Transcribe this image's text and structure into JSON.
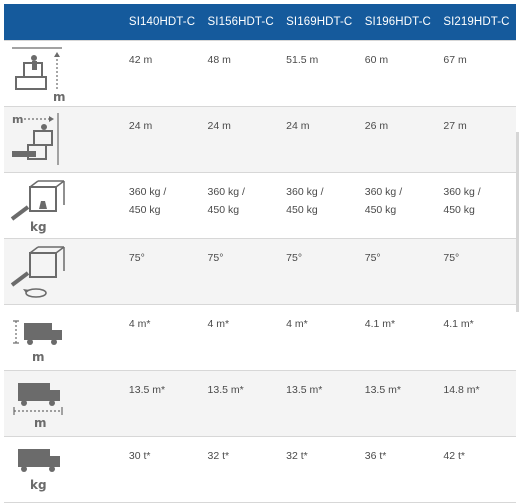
{
  "columns": [
    "SI140HDT-C",
    "SI156HDT-C",
    "SI169HDT-C",
    "SI196HDT-C",
    "SI219HDT-C"
  ],
  "rows": [
    {
      "icon": "working-height-icon",
      "icon_label": "m",
      "values": [
        "42 m",
        "48 m",
        "51.5 m",
        "60 m",
        "67 m"
      ]
    },
    {
      "icon": "horizontal-outreach-icon",
      "icon_label": "m",
      "values": [
        "24 m",
        "24 m",
        "24 m",
        "26 m",
        "27 m"
      ]
    },
    {
      "icon": "platform-capacity-icon",
      "icon_label": "kg",
      "values": [
        [
          "360 kg /",
          "450 kg"
        ],
        [
          "360 kg /",
          "450 kg"
        ],
        [
          "360 kg /",
          "450 kg"
        ],
        [
          "360 kg /",
          "450 kg"
        ],
        [
          "360 kg /",
          "450 kg"
        ]
      ]
    },
    {
      "icon": "platform-rotation-icon",
      "icon_label": "",
      "values": [
        "75°",
        "75°",
        "75°",
        "75°",
        "75°"
      ]
    },
    {
      "icon": "truck-height-icon",
      "icon_label": "m",
      "values": [
        "4 m*",
        "4 m*",
        "4 m*",
        "4.1 m*",
        "4.1 m*"
      ]
    },
    {
      "icon": "truck-length-icon",
      "icon_label": "m",
      "values": [
        "13.5 m*",
        "13.5 m*",
        "13.5 m*",
        "13.5 m*",
        "14.8 m*"
      ]
    },
    {
      "icon": "truck-weight-icon",
      "icon_label": "kg",
      "values": [
        "30 t*",
        "32 t*",
        "32 t*",
        "36 t*",
        "42 t*"
      ]
    }
  ],
  "colors": {
    "header_bg": "#155a9c",
    "header_text": "#ffffff",
    "row_alt_bg": "#f4f4f4",
    "border": "#d7d7d7",
    "text": "#4a4a4a",
    "icon": "#6b6b6b"
  }
}
